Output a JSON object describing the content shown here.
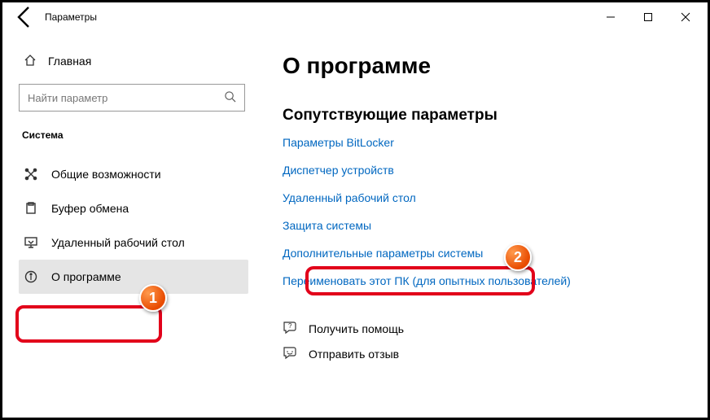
{
  "titlebar": {
    "title": "Параметры"
  },
  "sidebar": {
    "home": "Главная",
    "search_placeholder": "Найти параметр",
    "section": "Система",
    "items": [
      {
        "label": "Общие возможности"
      },
      {
        "label": "Буфер обмена"
      },
      {
        "label": "Удаленный рабочий стол"
      },
      {
        "label": "О программе"
      }
    ]
  },
  "main": {
    "title": "О программе",
    "subhead": "Сопутствующие параметры",
    "links": [
      "Параметры BitLocker",
      "Диспетчер устройств",
      "Удаленный рабочий стол",
      "Защита системы",
      "Дополнительные параметры системы",
      "Переименовать этот ПК (для опытных пользователей)"
    ],
    "help": "Получить помощь",
    "feedback": "Отправить отзыв"
  },
  "annotations": {
    "marker1": "1",
    "marker2": "2"
  }
}
